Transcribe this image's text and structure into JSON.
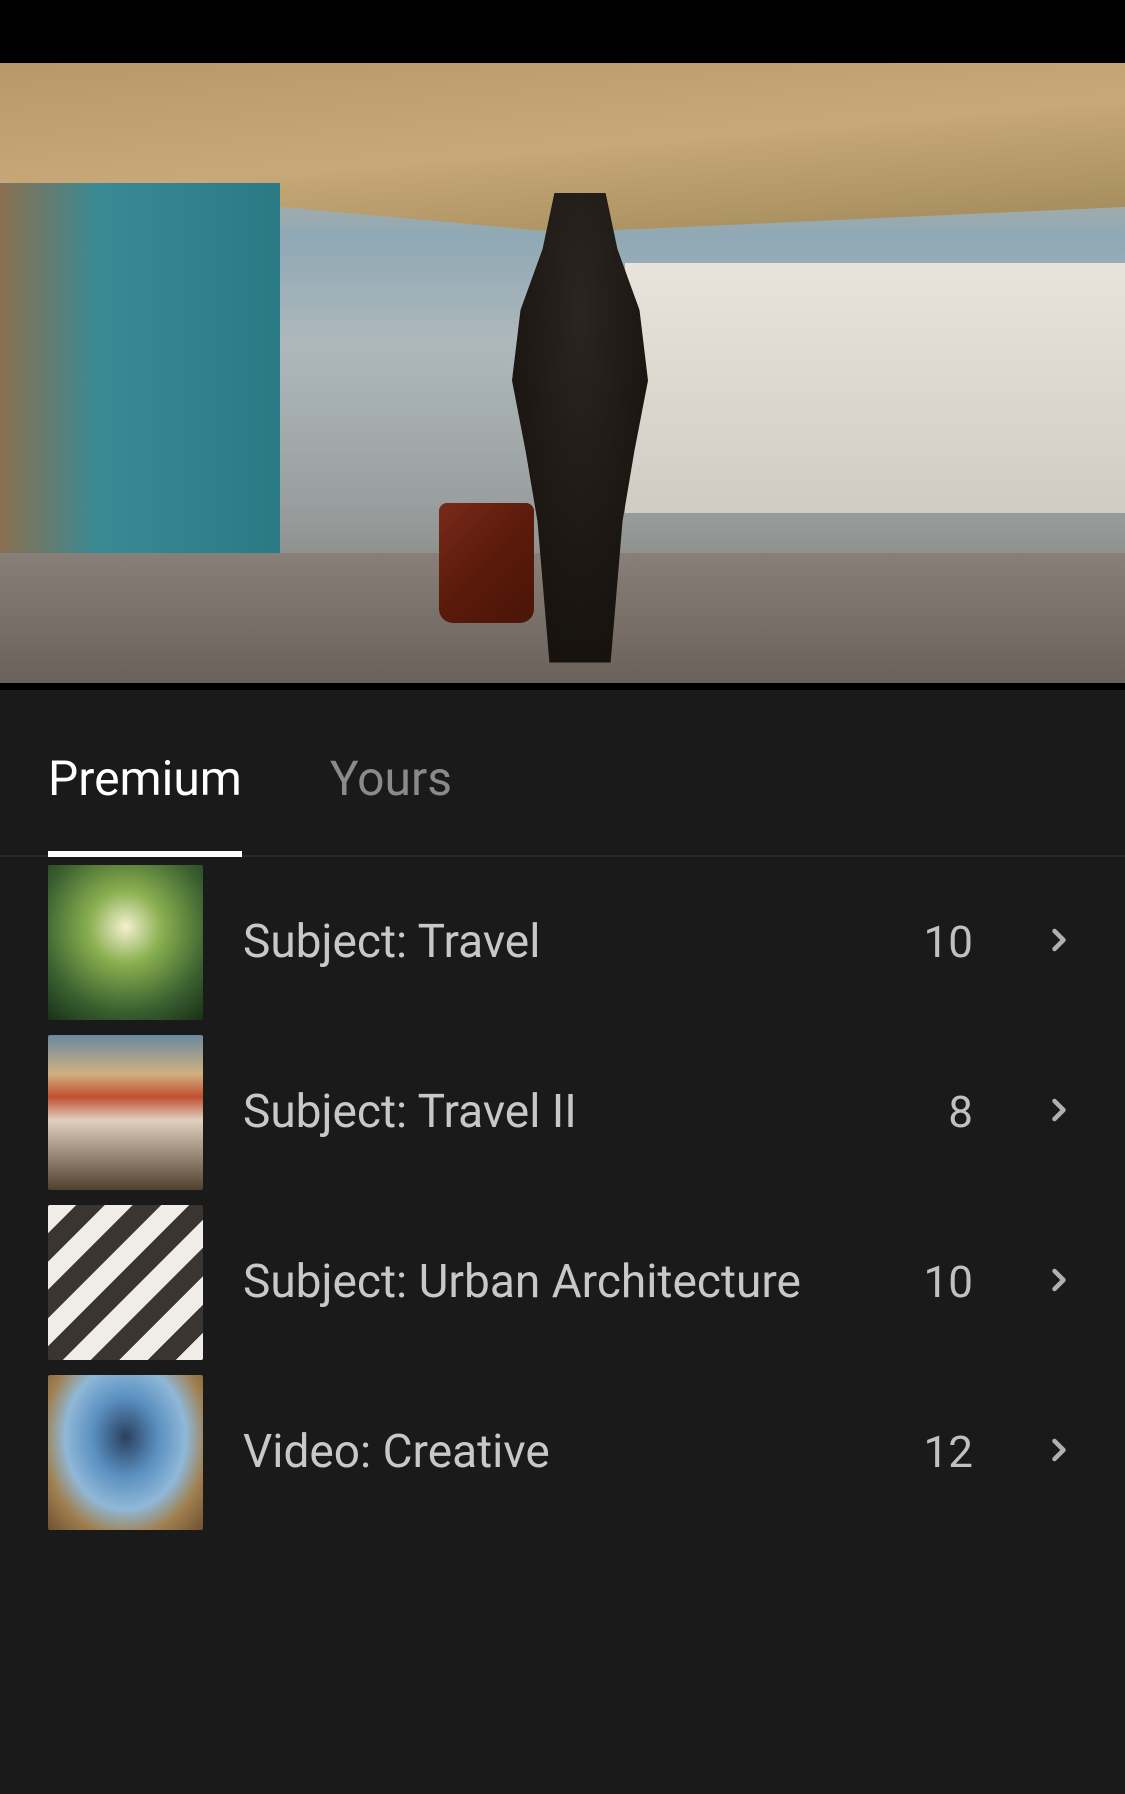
{
  "tabs": {
    "premium": "Premium",
    "yours": "Yours",
    "active": "premium"
  },
  "presets": [
    {
      "label": "Subject: Travel",
      "count": "10",
      "thumb": "travel"
    },
    {
      "label": "Subject: Travel II",
      "count": "8",
      "thumb": "travel2"
    },
    {
      "label": "Subject: Urban Architecture",
      "count": "10",
      "thumb": "urban"
    },
    {
      "label": "Video: Creative",
      "count": "12",
      "thumb": "video"
    }
  ]
}
